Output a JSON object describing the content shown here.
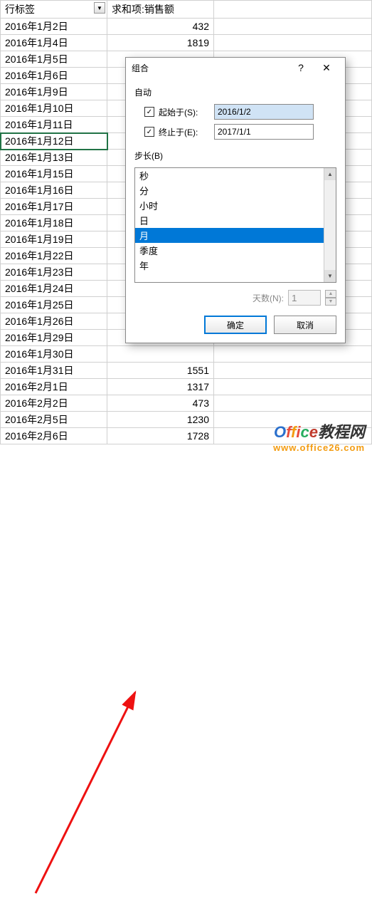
{
  "header": {
    "col1": "行标签",
    "col2": "求和项:销售额"
  },
  "rows": [
    {
      "date": "2016年1月2日",
      "val": "432"
    },
    {
      "date": "2016年1月4日",
      "val": "1819"
    },
    {
      "date": "2016年1月5日",
      "val": ""
    },
    {
      "date": "2016年1月6日",
      "val": ""
    },
    {
      "date": "2016年1月9日",
      "val": ""
    },
    {
      "date": "2016年1月10日",
      "val": ""
    },
    {
      "date": "2016年1月11日",
      "val": ""
    },
    {
      "date": "2016年1月12日",
      "val": ""
    },
    {
      "date": "2016年1月13日",
      "val": ""
    },
    {
      "date": "2016年1月15日",
      "val": ""
    },
    {
      "date": "2016年1月16日",
      "val": ""
    },
    {
      "date": "2016年1月17日",
      "val": ""
    },
    {
      "date": "2016年1月18日",
      "val": ""
    },
    {
      "date": "2016年1月19日",
      "val": ""
    },
    {
      "date": "2016年1月22日",
      "val": ""
    },
    {
      "date": "2016年1月23日",
      "val": ""
    },
    {
      "date": "2016年1月24日",
      "val": ""
    },
    {
      "date": "2016年1月25日",
      "val": ""
    },
    {
      "date": "2016年1月26日",
      "val": ""
    },
    {
      "date": "2016年1月29日",
      "val": ""
    },
    {
      "date": "2016年1月30日",
      "val": ""
    },
    {
      "date": "2016年1月31日",
      "val": "1551"
    },
    {
      "date": "2016年2月1日",
      "val": "1317"
    },
    {
      "date": "2016年2月2日",
      "val": "473"
    },
    {
      "date": "2016年2月5日",
      "val": "1230"
    },
    {
      "date": "2016年2月6日",
      "val": "1728"
    }
  ],
  "selected_row_index": 7,
  "dialog": {
    "title": "组合",
    "auto_label": "自动",
    "start_label": "起始于(S):",
    "start_value": "2016/1/2",
    "end_label": "终止于(E):",
    "end_value": "2017/1/1",
    "step_label": "步长(B)",
    "step_options": [
      "秒",
      "分",
      "小时",
      "日",
      "月",
      "季度",
      "年"
    ],
    "step_selected_index": 4,
    "days_label": "天数(N):",
    "days_value": "1",
    "ok": "确定",
    "cancel": "取消"
  },
  "watermark": {
    "line1_parts": [
      "O",
      "f",
      "f",
      "i",
      "c",
      "e",
      "教程网"
    ],
    "line2": "www.office26.com"
  }
}
